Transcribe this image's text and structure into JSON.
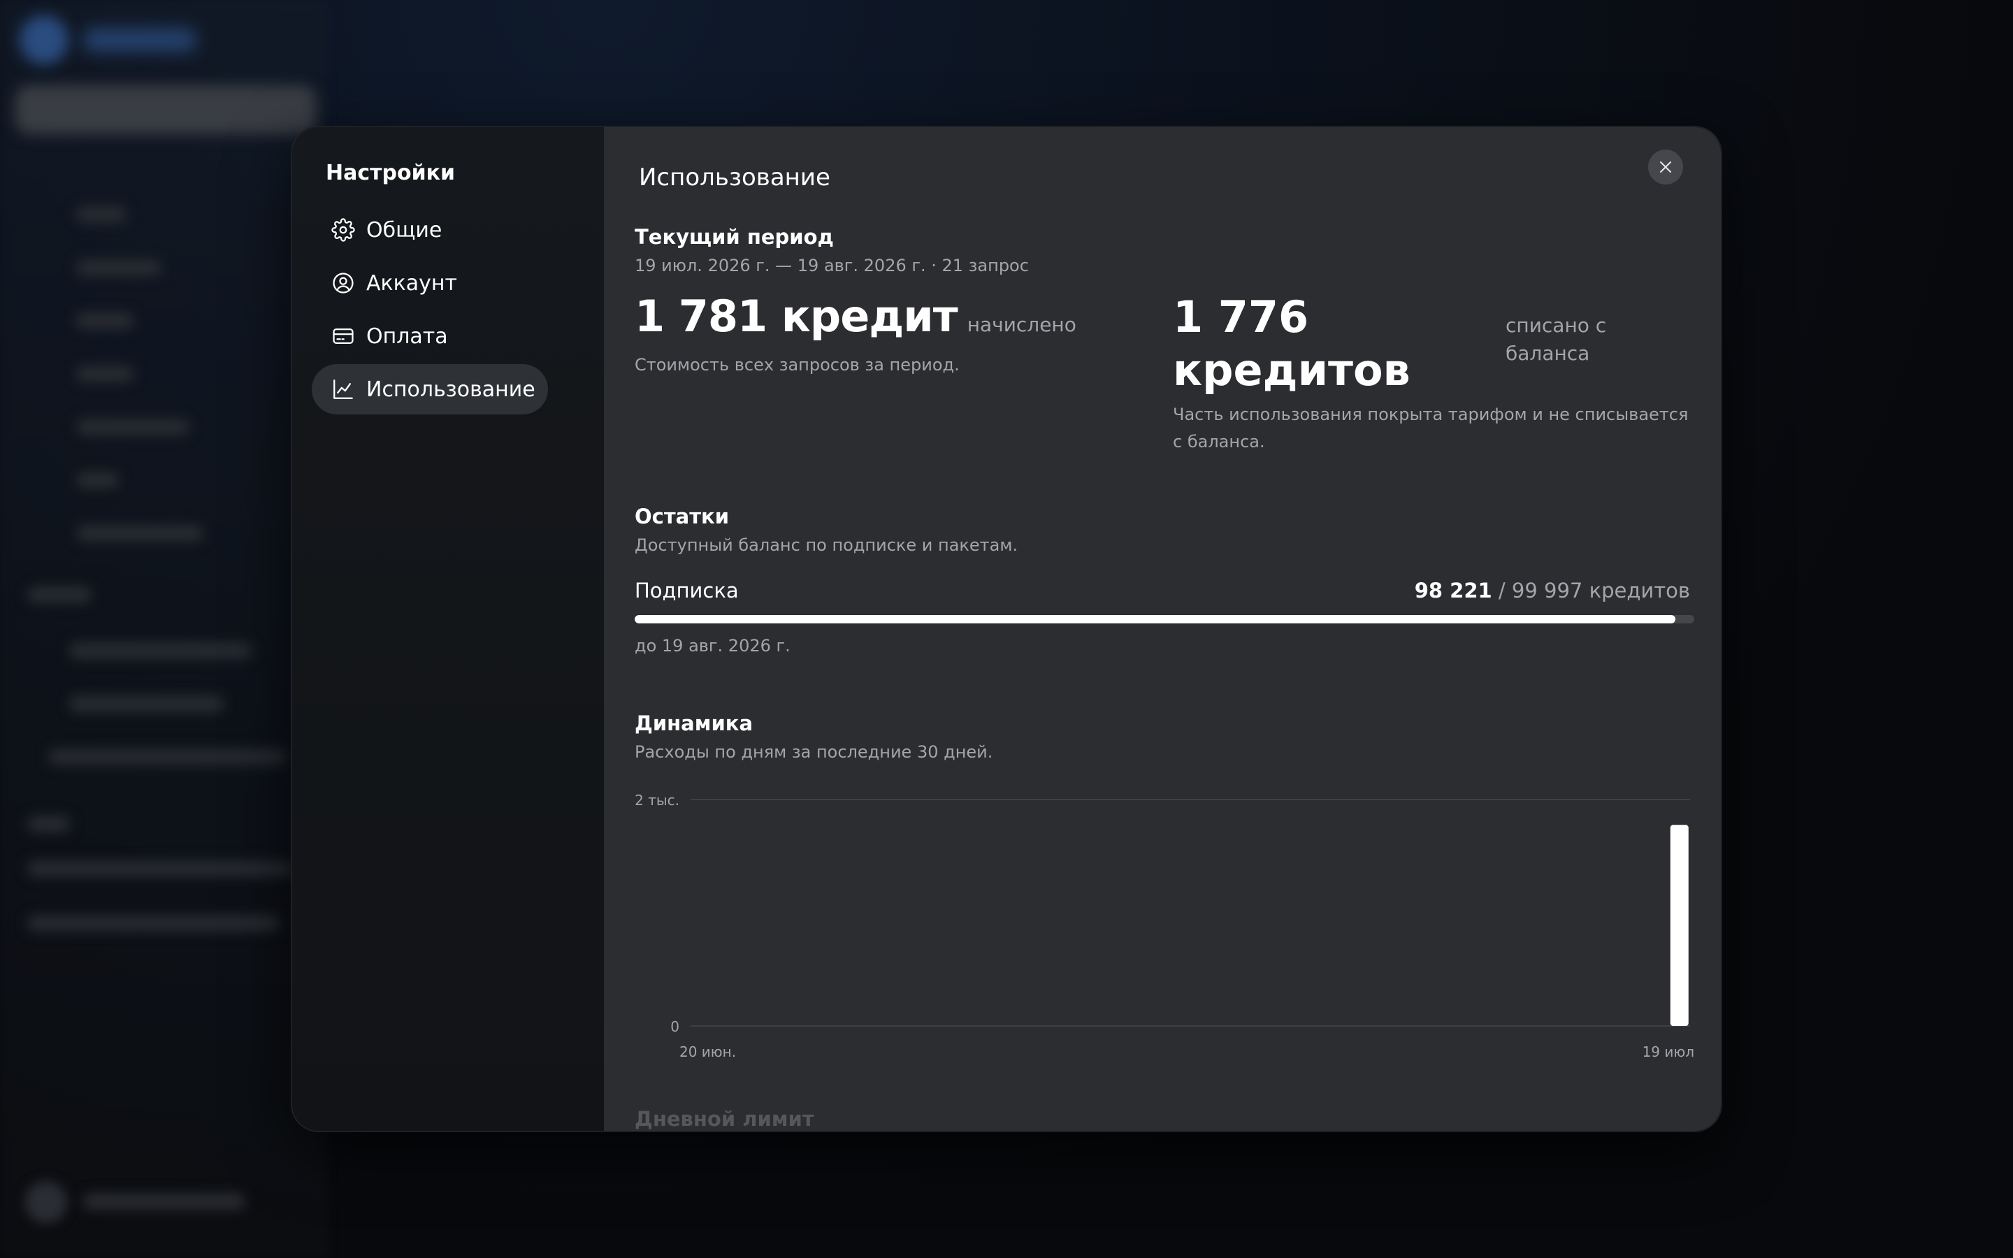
{
  "settings": {
    "title": "Настройки",
    "nav": [
      {
        "label": "Общие",
        "icon": "gear-icon"
      },
      {
        "label": "Аккаунт",
        "icon": "user-circle-icon"
      },
      {
        "label": "Оплата",
        "icon": "credit-card-icon"
      },
      {
        "label": "Использование",
        "icon": "chart-line-icon",
        "active": true
      }
    ]
  },
  "usage": {
    "title": "Использование",
    "period": {
      "title": "Текущий период",
      "range": "19 июл. 2026 г. — 19 авг. 2026 г. · 21 запрос"
    },
    "charged": {
      "value": "1 781 кредит",
      "label": "начислено",
      "desc": "Стоимость всех запросов за период."
    },
    "debited": {
      "value": "1 776 кредитов",
      "label": "списано с баланса",
      "desc": "Часть использования покрыта тарифом и не списывается с баланса."
    },
    "balances": {
      "title": "Остатки",
      "desc": "Доступный баланс по подписке и пакетам.",
      "subscription": {
        "name": "Подписка",
        "used_label": "98 221",
        "total_label": "/ 99 997 кредитов",
        "fraction": 0.9822,
        "until": "до 19 авг. 2026 г."
      }
    },
    "dynamics": {
      "title": "Динамика",
      "desc": "Расходы по дням за последние 30 дней."
    },
    "next_section": "Дневной лимит"
  },
  "chart_data": {
    "type": "bar",
    "x": [
      "20 июн.",
      "19 июл"
    ],
    "tick_labels_y": [
      "2 тыс.",
      "0"
    ],
    "ylim": [
      0,
      2000
    ],
    "days": 30,
    "values": [
      0,
      0,
      0,
      0,
      0,
      0,
      0,
      0,
      0,
      0,
      0,
      0,
      0,
      0,
      0,
      0,
      0,
      0,
      0,
      0,
      0,
      0,
      0,
      0,
      0,
      0,
      0,
      0,
      0,
      1776
    ],
    "grid": true,
    "bar_color": "#ffffff"
  },
  "colors": {
    "content_bg": "#2c2d30",
    "nav_bg": "#131518",
    "accent": "#ffffff",
    "muted": "#a3a5aa"
  }
}
